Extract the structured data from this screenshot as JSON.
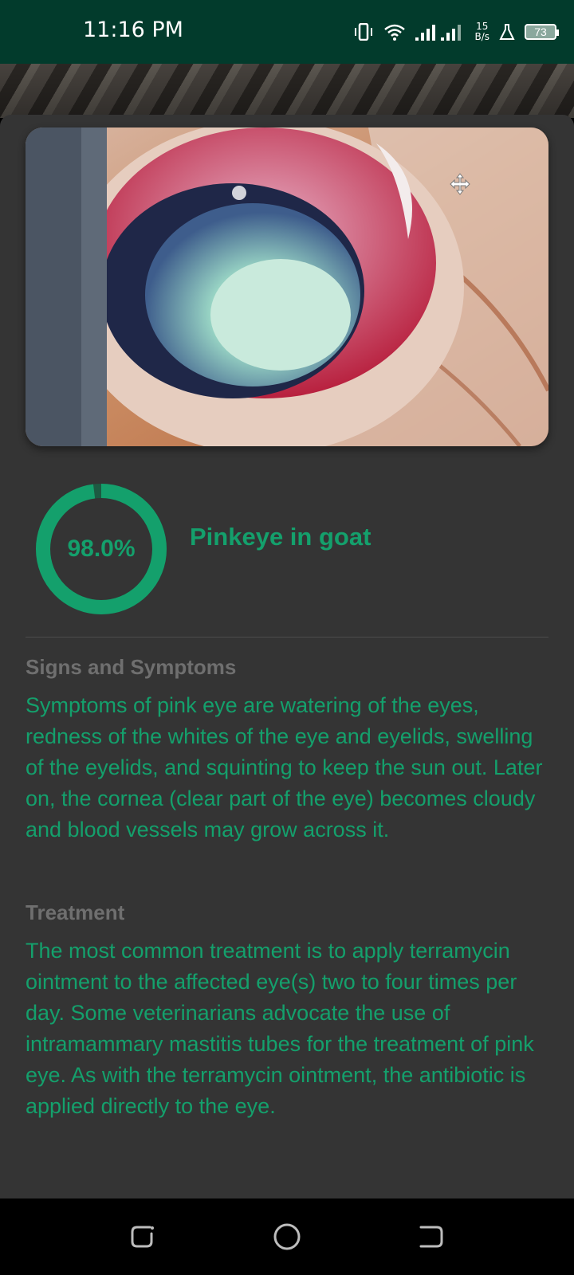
{
  "status_bar": {
    "time": "11:16 PM",
    "net_speed_value": "15",
    "net_speed_unit": "B/s",
    "battery": "73"
  },
  "result": {
    "confidence": 0.98,
    "confidence_label": "98.0%",
    "disease_name": "Pinkeye in goat"
  },
  "sections": {
    "signs_title": "Signs and Symptoms",
    "signs_body": "Symptoms of pink eye are watering of the eyes, redness of the whites of the eye and eyelids, swelling of the eyelids, and squinting to keep the sun out. Later on, the cornea (clear part of the eye) becomes cloudy and blood vessels may grow across it.",
    "treatment_title": "Treatment",
    "treatment_body": "The most common treatment is to apply terramycin ointment to the affected eye(s) two to four times per day. Some veterinarians advocate the use of intramammary mastitis tubes for the treatment of pink eye. As with the terramycin ointment, the antibiotic is applied directly to the eye."
  },
  "colors": {
    "accent": "#14a06c",
    "status_bar": "#023b2c",
    "sheet": "#343434"
  },
  "icons": [
    "vibrate-icon",
    "wifi-icon",
    "signal-icon",
    "flask-icon",
    "battery-icon",
    "move-icon",
    "recents-icon",
    "home-icon",
    "back-icon"
  ]
}
